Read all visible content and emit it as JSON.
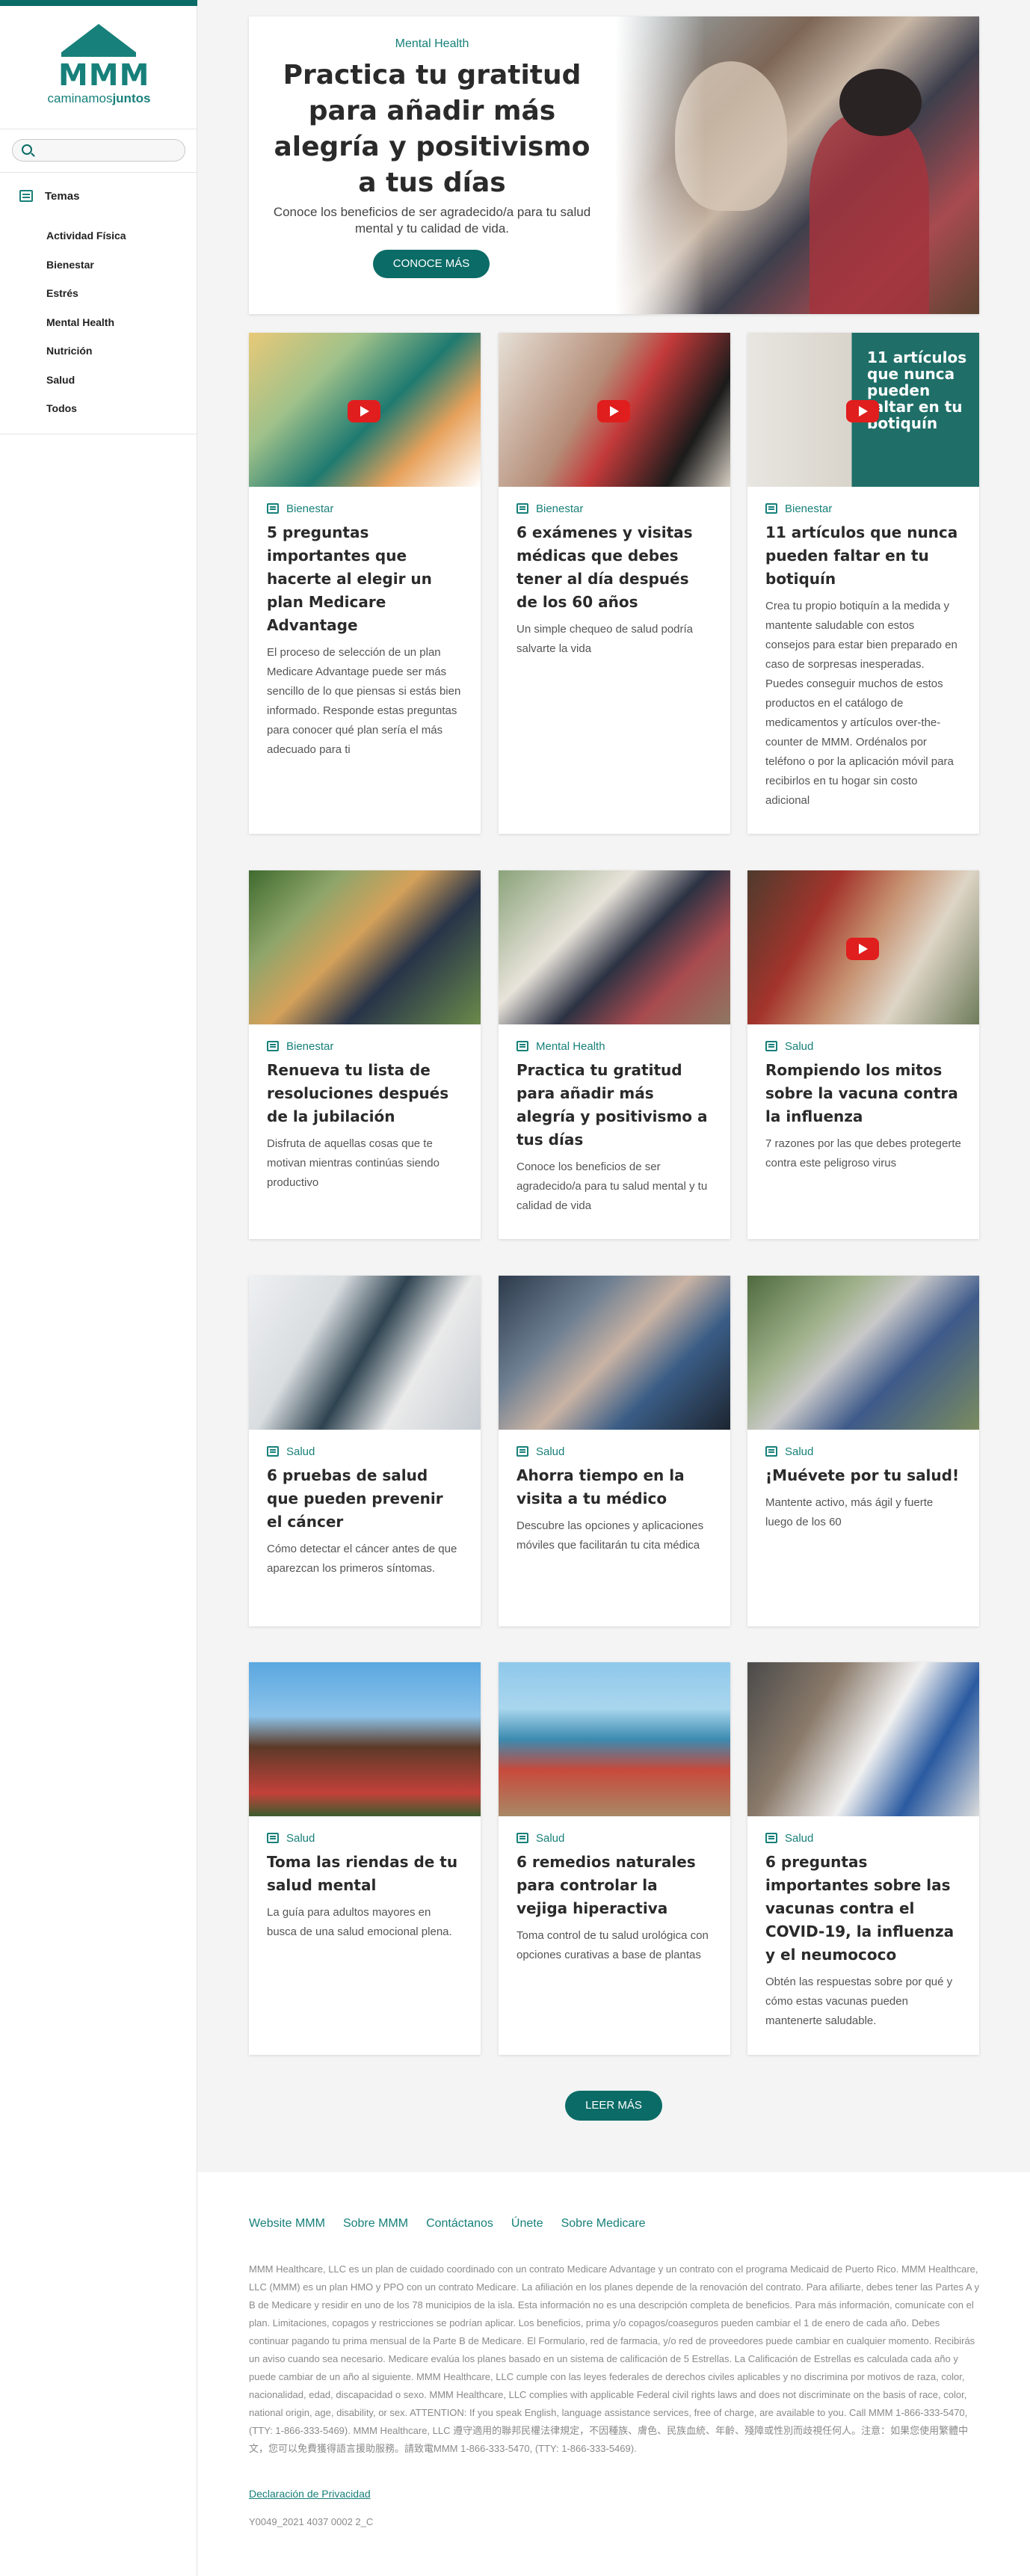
{
  "brand": {
    "name": "MMM",
    "tagline_prefix": "caminamos",
    "tagline_suffix": "juntos",
    "accent_color": "#17807a",
    "dark_accent": "#0b6b66"
  },
  "search": {
    "placeholder": "",
    "icon": "search-icon"
  },
  "sidebar": {
    "section_label": "Temas",
    "topics": [
      "Actividad Física",
      "Bienestar",
      "Estrés",
      "Mental Health",
      "Nutrición",
      "Salud",
      "Todos"
    ]
  },
  "hero": {
    "category": "Mental Health",
    "title": "Practica tu gratitud para añadir más alegría y positivismo a tus días",
    "description": "Conoce los beneficios de ser agradecido/a para tu salud mental y tu calidad de vida.",
    "button": "CONOCE MÁS"
  },
  "cards": [
    {
      "category": "Bienestar",
      "title": "5 preguntas importantes que hacerte al elegir un plan Medicare Advantage",
      "description": "El proceso de selección de un plan Medicare Advantage puede ser más sencillo de lo que piensas si estás bien informado. Responde estas preguntas para conocer qué plan sería el más adecuado para ti",
      "video": true
    },
    {
      "category": "Bienestar",
      "title": "6 exámenes y visitas médicas que debes tener al día después de los 60 años",
      "description": "Un simple chequeo de salud podría salvarte la vida",
      "video": true
    },
    {
      "category": "Bienestar",
      "title": "11 artículos que nunca pueden faltar en tu botiquín",
      "description": "Crea tu propio botiquín a la medida y mantente saludable con estos consejos para estar bien preparado en caso de sorpresas inesperadas. Puedes conseguir muchos de estos productos en el catálogo de medicamentos y artículos over-the-counter de MMM. Ordénalos por teléfono o por la aplicación móvil para recibirlos en tu hogar sin costo adicional",
      "video": true,
      "image_text": "11 artículos que nunca pueden faltar en tu botiquín"
    },
    {
      "category": "Bienestar",
      "title": "Renueva tu lista de resoluciones después de la jubilación",
      "description": "Disfruta de aquellas cosas que te motivan mientras continúas siendo productivo",
      "video": false
    },
    {
      "category": "Mental Health",
      "title": "Practica tu gratitud para añadir más alegría y positivismo a tus días",
      "description": "Conoce los beneficios de ser agradecido/a para tu salud mental y tu calidad de vida",
      "video": false
    },
    {
      "category": "Salud",
      "title": "Rompiendo los mitos sobre la vacuna contra la influenza",
      "description": "7 razones por las que debes protegerte contra este peligroso virus",
      "video": true
    },
    {
      "category": "Salud",
      "title": "6 pruebas de salud que pueden prevenir el cáncer",
      "description": "Cómo detectar el cáncer antes de que aparezcan los primeros síntomas.",
      "video": false
    },
    {
      "category": "Salud",
      "title": "Ahorra tiempo en la visita a tu médico",
      "description": "Descubre las opciones y aplicaciones móviles que facilitarán tu cita médica",
      "video": false
    },
    {
      "category": "Salud",
      "title": "¡Muévete por tu salud!",
      "description": "Mantente activo, más ágil y fuerte luego de los 60",
      "video": false
    },
    {
      "category": "Salud",
      "title": "Toma las riendas de tu salud mental",
      "description": "La guía para adultos mayores en busca de una salud emocional plena.",
      "video": false
    },
    {
      "category": "Salud",
      "title": "6 remedios naturales para controlar la vejiga hiperactiva",
      "description": "Toma control de tu salud urológica con opciones curativas a base de plantas",
      "video": false
    },
    {
      "category": "Salud",
      "title": "6 preguntas importantes sobre las vacunas contra el COVID-19, la influenza y el neumococo",
      "description": "Obtén las respuestas sobre por qué y cómo estas vacunas pueden mantenerte saludable.",
      "video": false
    }
  ],
  "load_more": "LEER MÁS",
  "footer": {
    "links": [
      "Website MMM",
      "Sobre MMM",
      "Contáctanos",
      "Únete",
      "Sobre Medicare"
    ],
    "disclaimer": "MMM Healthcare, LLC es un plan de cuidado coordinado con un contrato Medicare Advantage y un contrato con el programa Medicaid de Puerto Rico. MMM Healthcare, LLC (MMM) es un plan HMO y PPO con un contrato Medicare. La afiliación en los planes depende de la renovación del contrato. Para afiliarte, debes tener las Partes A y B de Medicare y residir en uno de los 78 municipios de la isla. Esta información no es una descripción completa de beneficios. Para más información, comunícate con el plan. Limitaciones, copagos y restricciones se podrían aplicar. Los beneficios, prima y/o copagos/coaseguros pueden cambiar el 1 de enero de cada año. Debes continuar pagando tu prima mensual de la Parte B de Medicare. El Formulario, red de farmacia, y/o red de proveedores puede cambiar en cualquier momento. Recibirás un aviso cuando sea necesario. Medicare evalúa los planes basado en un sistema de calificación de 5 Estrellas. La Calificación de Estrellas es calculada cada año y puede cambiar de un año al siguiente. MMM Healthcare, LLC cumple con las leyes federales de derechos civiles aplicables y no discrimina por motivos de raza, color, nacionalidad, edad, discapacidad o sexo. MMM Healthcare, LLC complies with applicable Federal civil rights laws and does not discriminate on the basis of race, color, national origin, age, disability, or sex. ATTENTION: If you speak English, language assistance services, free of charge, are available to you. Call MMM 1-866-333-5470, (TTY: 1-866-333-5469). MMM Healthcare, LLC 遵守適用的聯邦民權法律規定，不因種族、膚色、民族血統、年齡、殘障或性別而歧視任何人。注意：如果您使用繁體中文，您可以免費獲得語言援助服務。請致電MMM 1-866-333-5470, (TTY: 1-866-333-5469).",
    "privacy": "Declaración de Privacidad",
    "code": "Y0049_2021 4037 0002 2_C"
  }
}
